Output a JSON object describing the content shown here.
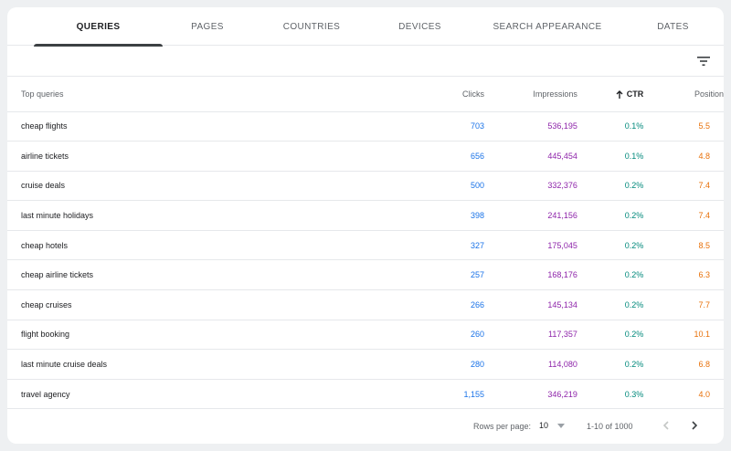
{
  "tabs": [
    {
      "label": "QUERIES",
      "active": true
    },
    {
      "label": "PAGES",
      "active": false
    },
    {
      "label": "COUNTRIES",
      "active": false
    },
    {
      "label": "DEVICES",
      "active": false
    },
    {
      "label": "SEARCH APPEARANCE",
      "active": false
    },
    {
      "label": "DATES",
      "active": false
    }
  ],
  "table": {
    "headers": {
      "query": "Top queries",
      "clicks": "Clicks",
      "impressions": "Impressions",
      "ctr": "CTR",
      "position": "Position"
    },
    "sorted_column": "ctr",
    "sort_direction": "ascending",
    "rows": [
      {
        "query": "cheap flights",
        "clicks": "703",
        "impressions": "536,195",
        "ctr": "0.1%",
        "position": "5.5"
      },
      {
        "query": "airline tickets",
        "clicks": "656",
        "impressions": "445,454",
        "ctr": "0.1%",
        "position": "4.8"
      },
      {
        "query": "cruise deals",
        "clicks": "500",
        "impressions": "332,376",
        "ctr": "0.2%",
        "position": "7.4"
      },
      {
        "query": "last minute holidays",
        "clicks": "398",
        "impressions": "241,156",
        "ctr": "0.2%",
        "position": "7.4"
      },
      {
        "query": "cheap hotels",
        "clicks": "327",
        "impressions": "175,045",
        "ctr": "0.2%",
        "position": "8.5"
      },
      {
        "query": "cheap airline tickets",
        "clicks": "257",
        "impressions": "168,176",
        "ctr": "0.2%",
        "position": "6.3"
      },
      {
        "query": "cheap cruises",
        "clicks": "266",
        "impressions": "145,134",
        "ctr": "0.2%",
        "position": "7.7"
      },
      {
        "query": "flight booking",
        "clicks": "260",
        "impressions": "117,357",
        "ctr": "0.2%",
        "position": "10.1"
      },
      {
        "query": "last minute cruise deals",
        "clicks": "280",
        "impressions": "114,080",
        "ctr": "0.2%",
        "position": "6.8"
      },
      {
        "query": "travel agency",
        "clicks": "1,155",
        "impressions": "346,219",
        "ctr": "0.3%",
        "position": "4.0"
      }
    ]
  },
  "footer": {
    "rows_per_page_label": "Rows per page:",
    "rows_per_page_value": "10",
    "range_text": "1-10 of 1000"
  },
  "colors": {
    "clicks": "#1a73e8",
    "impressions": "#8e24aa",
    "ctr": "#00897b",
    "position": "#e8710a"
  },
  "icons": {
    "filter": "filter-icon",
    "sort": "arrow-up-icon",
    "dropdown": "caret-down-icon",
    "prev": "chevron-left-icon",
    "next": "chevron-right-icon"
  }
}
